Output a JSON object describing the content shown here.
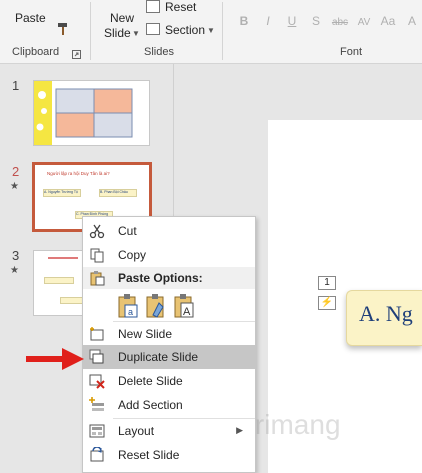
{
  "ribbon": {
    "paste_label": "Paste",
    "clipboard_label": "Clipboard",
    "new_slide_label_1": "New",
    "new_slide_label_2": "Slide",
    "reset_label": "Reset",
    "section_label": "Section",
    "slides_label": "Slides",
    "font_label": "Font",
    "font_icons": [
      "B",
      "I",
      "U",
      "S",
      "abc",
      "AV",
      "Aa",
      "A"
    ]
  },
  "thumbnails": [
    {
      "number": "1",
      "starred": false
    },
    {
      "number": "2",
      "starred": true
    },
    {
      "number": "3",
      "starred": true
    }
  ],
  "star_glyph": "★",
  "slide2_title": "Người lập ra hội Duy Tân là ai?",
  "slide2_options": [
    "A. Nguyễn Trường Tộ",
    "B. Phan Bội Châu",
    "C. Phan Đình Phùng"
  ],
  "canvas": {
    "marker_1": "1",
    "title_text": "A. Ng"
  },
  "context_menu": {
    "cut": "Cut",
    "copy": "Copy",
    "paste_options": "Paste Options:",
    "new_slide": "New Slide",
    "duplicate_slide": "Duplicate Slide",
    "delete_slide": "Delete Slide",
    "add_section": "Add Section",
    "layout": "Layout",
    "reset_slide": "Reset Slide"
  },
  "colors": {
    "accent_red": "#e0201b",
    "active_thumb_border": "#c55a3c",
    "highlight": "#c6c6c6",
    "title_box_fill": "#fbf3c7"
  }
}
